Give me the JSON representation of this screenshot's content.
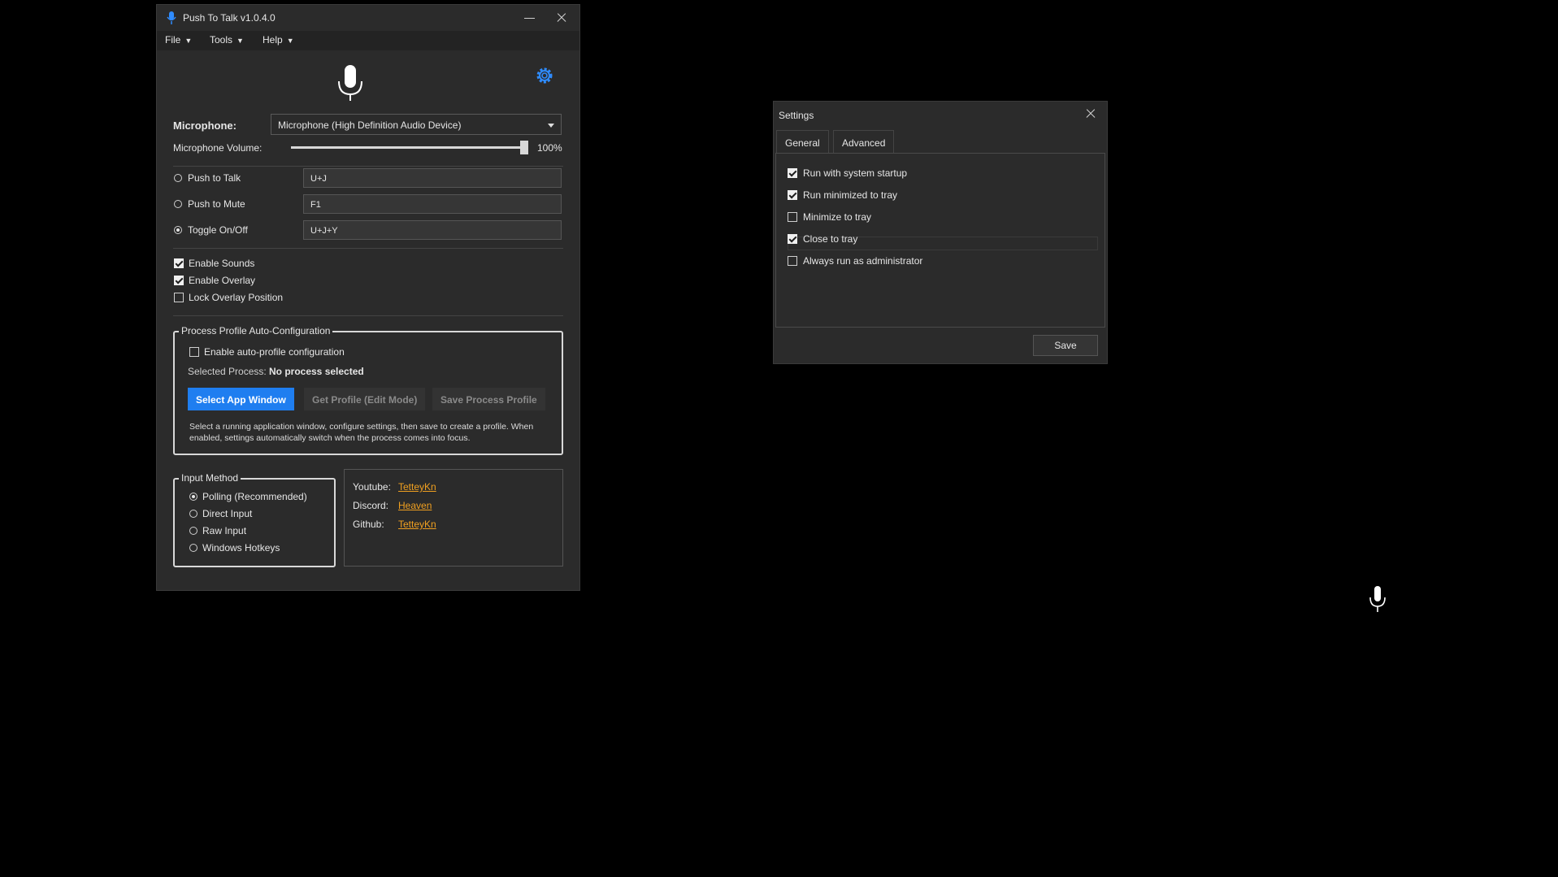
{
  "main_window": {
    "title": "Push To Talk v1.0.4.0",
    "menu": [
      "File",
      "Tools",
      "Help"
    ],
    "microphone_label": "Microphone:",
    "microphone_value": "Microphone (High Definition Audio Device)",
    "volume_label": "Microphone Volume:",
    "volume_value": "100%",
    "volume_level": 1.0,
    "modes": [
      {
        "label": "Push to Talk",
        "key": "U+J",
        "selected": false
      },
      {
        "label": "Push to Mute",
        "key": "F1",
        "selected": false
      },
      {
        "label": "Toggle On/Off",
        "key": "U+J+Y",
        "selected": true
      }
    ],
    "options": [
      {
        "label": "Enable Sounds",
        "checked": true
      },
      {
        "label": "Enable Overlay",
        "checked": true
      },
      {
        "label": "Lock Overlay Position",
        "checked": false
      }
    ],
    "profile": {
      "title": "Process Profile Auto-Configuration",
      "enable_label": "Enable auto-profile configuration",
      "enable_checked": false,
      "selected_label": "Selected Process:",
      "selected_value": "No process selected",
      "select_btn": "Select App Window",
      "get_btn": "Get Profile (Edit Mode)",
      "save_btn": "Save Process Profile",
      "help": "Select a running application window, configure settings, then save to create a profile. When enabled, settings automatically switch when the process comes into focus."
    },
    "input_method": {
      "title": "Input Method",
      "options": [
        {
          "label": "Polling (Recommended)",
          "selected": true
        },
        {
          "label": "Direct Input",
          "selected": false
        },
        {
          "label": "Raw Input",
          "selected": false
        },
        {
          "label": "Windows Hotkeys",
          "selected": false
        }
      ]
    },
    "links": [
      {
        "label": "Youtube:",
        "value": "TetteyKn"
      },
      {
        "label": "Discord:",
        "value": "Heaven"
      },
      {
        "label": "Github:",
        "value": "TetteyKn"
      }
    ]
  },
  "settings_window": {
    "title": "Settings",
    "tabs": [
      "General",
      "Advanced"
    ],
    "active_tab": "General",
    "options": [
      {
        "label": "Run with system startup",
        "checked": true
      },
      {
        "label": "Run minimized to tray",
        "checked": true
      },
      {
        "label": "Minimize to tray",
        "checked": false
      },
      {
        "label": "Close to tray",
        "checked": true
      },
      {
        "label": "Always run as administrator",
        "checked": false
      }
    ],
    "save_label": "Save"
  },
  "colors": {
    "accent": "#1f7ef0",
    "link": "#f0a020",
    "window_bg": "#2b2b2b",
    "desktop_bg": "#000000"
  }
}
